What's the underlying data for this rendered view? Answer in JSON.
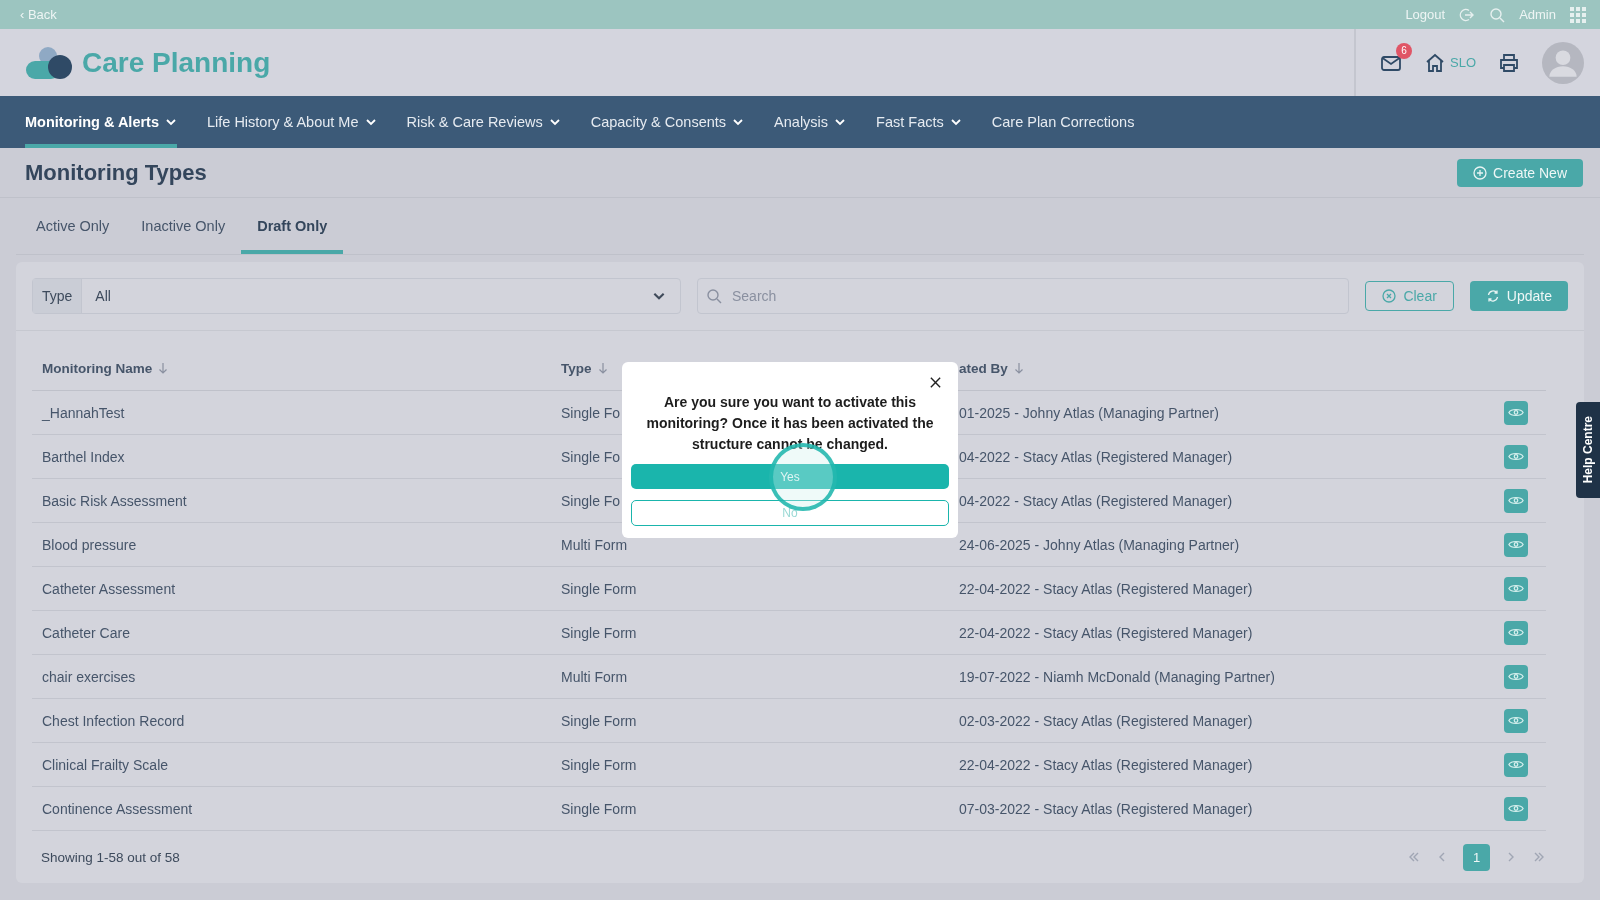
{
  "top_bar": {
    "back": "‹ Back",
    "logout": "Logout",
    "user": "Admin"
  },
  "header": {
    "app_title": "Care Planning",
    "mail_badge": "6",
    "home_label": "SLO"
  },
  "nav": [
    {
      "label": "Monitoring & Alerts",
      "dropdown": true,
      "selected": true
    },
    {
      "label": "Life History & About Me",
      "dropdown": true,
      "selected": false
    },
    {
      "label": "Risk & Care Reviews",
      "dropdown": true,
      "selected": false
    },
    {
      "label": "Capacity & Consents",
      "dropdown": true,
      "selected": false
    },
    {
      "label": "Analysis",
      "dropdown": true,
      "selected": false
    },
    {
      "label": "Fast Facts",
      "dropdown": true,
      "selected": false
    },
    {
      "label": "Care Plan Corrections",
      "dropdown": false,
      "selected": false
    }
  ],
  "page_title": "Monitoring Types",
  "create_button": "Create New",
  "tabs": [
    {
      "label": "Active Only",
      "selected": false
    },
    {
      "label": "Inactive Only",
      "selected": false
    },
    {
      "label": "Draft Only",
      "selected": true
    }
  ],
  "filters": {
    "type_label": "Type",
    "type_value": "All",
    "search_placeholder": "Search",
    "clear": "Clear",
    "update": "Update"
  },
  "table": {
    "columns": [
      "Monitoring Name",
      "Type",
      "ated By"
    ],
    "rows": [
      {
        "name": "_HannahTest",
        "type": "Single Fo",
        "created": "01-2025 - Johny Atlas (Managing Partner)"
      },
      {
        "name": "Barthel Index",
        "type": "Single Fo",
        "created": "04-2022 - Stacy Atlas (Registered Manager)"
      },
      {
        "name": "Basic Risk Assessment",
        "type": "Single Fo",
        "created": "04-2022 - Stacy Atlas (Registered Manager)"
      },
      {
        "name": "Blood pressure",
        "type": "Multi Form",
        "created": "24-06-2025 - Johny Atlas (Managing Partner)"
      },
      {
        "name": "Catheter Assessment",
        "type": "Single Form",
        "created": "22-04-2022 - Stacy Atlas (Registered Manager)"
      },
      {
        "name": "Catheter Care",
        "type": "Single Form",
        "created": "22-04-2022 - Stacy Atlas (Registered Manager)"
      },
      {
        "name": "chair exercises",
        "type": "Multi Form",
        "created": "19-07-2022 - Niamh McDonald (Managing Partner)"
      },
      {
        "name": "Chest Infection Record",
        "type": "Single Form",
        "created": "02-03-2022 - Stacy Atlas (Registered Manager)"
      },
      {
        "name": "Clinical Frailty Scale",
        "type": "Single Form",
        "created": "22-04-2022 - Stacy Atlas (Registered Manager)"
      },
      {
        "name": "Continence Assessment",
        "type": "Single Form",
        "created": "07-03-2022 - Stacy Atlas (Registered Manager)"
      }
    ]
  },
  "footer": {
    "summary": "Showing 1-58 out of 58",
    "pages": [
      {
        "label": "1",
        "selected": true
      }
    ]
  },
  "help_tab": "Help Centre",
  "dialog": {
    "message": "Are you sure you want to activate this monitoring? Once it has been activated the structure cannot be changed.",
    "confirm": "Yes",
    "cancel": "No"
  }
}
